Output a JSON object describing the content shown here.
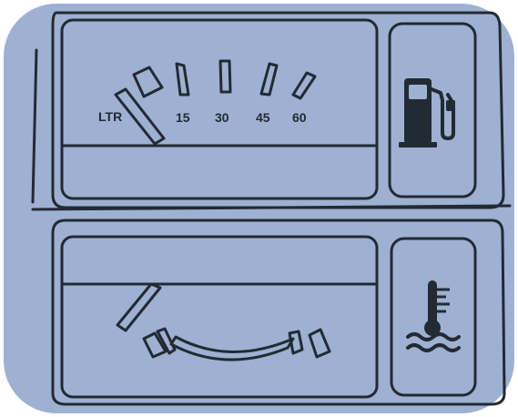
{
  "fuel_gauge": {
    "icon": "fuel-pump-icon",
    "scale_labels": [
      "LTR",
      "15",
      "30",
      "45",
      "60"
    ],
    "level_fraction": 0.0,
    "segment_count": 5
  },
  "temperature_gauge": {
    "icon": "coolant-temperature-icon",
    "level_fraction": 0.0,
    "segment_count": 2
  },
  "colors": {
    "panel_background": "#9eb1d2",
    "line": "#222a33",
    "outer_background": "#ffffff"
  }
}
